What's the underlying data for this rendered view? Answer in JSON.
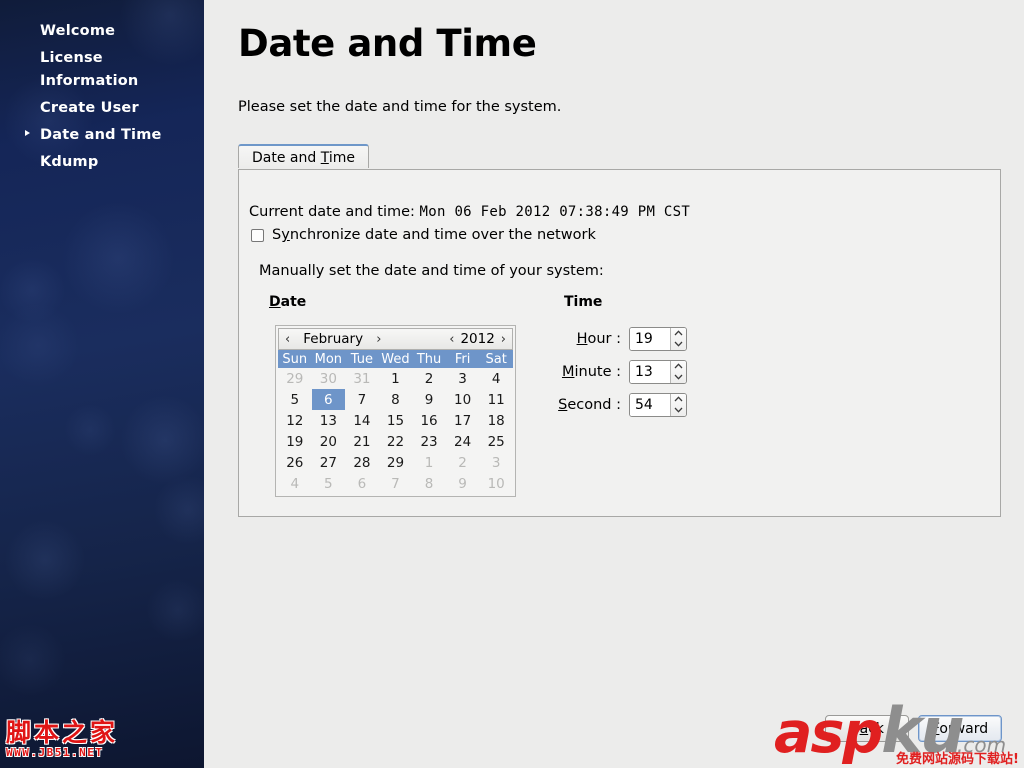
{
  "sidebar": {
    "items": [
      {
        "label": "Welcome",
        "current": false
      },
      {
        "label": "License\nInformation",
        "current": false
      },
      {
        "label": "Create User",
        "current": false
      },
      {
        "label": "Date and Time",
        "current": true
      },
      {
        "label": "Kdump",
        "current": false
      }
    ]
  },
  "watermark_left": {
    "brand": "脚本之家",
    "url": "WWW.JB51.NET"
  },
  "watermark_right": {
    "part1": "asp",
    "part2": "ku",
    "suffix": ".com",
    "subtitle": "免费网站源码下载站!"
  },
  "page": {
    "title": "Date and Time",
    "subtitle": "Please set the date and time for the system."
  },
  "tabs": [
    {
      "label": "Date and Time",
      "mnemonic": "T",
      "active": true
    }
  ],
  "panel": {
    "current_label": "Current date and time:",
    "current_value": "Mon 06 Feb 2012 07:38:49 PM CST",
    "sync_checkbox": {
      "label_before": "S",
      "mnemonic": "y",
      "label_after": "nchronize date and time over the network",
      "checked": false
    },
    "manual_label": "Manually set the date and time of your system:",
    "date_group_label": "Date",
    "date_group_mnemonic": "D",
    "time_group_label": "Time"
  },
  "calendar": {
    "prev_month_icon": "‹",
    "next_month_icon": "›",
    "month": "February",
    "prev_year_icon": "‹",
    "next_year_icon": "›",
    "year": "2012",
    "weekdays": [
      "Sun",
      "Mon",
      "Tue",
      "Wed",
      "Thu",
      "Fri",
      "Sat"
    ],
    "selected_day": 6,
    "weeks": [
      [
        {
          "d": "29",
          "dim": true
        },
        {
          "d": "30",
          "dim": true
        },
        {
          "d": "31",
          "dim": true
        },
        {
          "d": "1"
        },
        {
          "d": "2"
        },
        {
          "d": "3"
        },
        {
          "d": "4"
        }
      ],
      [
        {
          "d": "5"
        },
        {
          "d": "6",
          "sel": true
        },
        {
          "d": "7"
        },
        {
          "d": "8"
        },
        {
          "d": "9"
        },
        {
          "d": "10"
        },
        {
          "d": "11"
        }
      ],
      [
        {
          "d": "12"
        },
        {
          "d": "13"
        },
        {
          "d": "14"
        },
        {
          "d": "15"
        },
        {
          "d": "16"
        },
        {
          "d": "17"
        },
        {
          "d": "18"
        }
      ],
      [
        {
          "d": "19"
        },
        {
          "d": "20"
        },
        {
          "d": "21"
        },
        {
          "d": "22"
        },
        {
          "d": "23"
        },
        {
          "d": "24"
        },
        {
          "d": "25"
        }
      ],
      [
        {
          "d": "26"
        },
        {
          "d": "27"
        },
        {
          "d": "28"
        },
        {
          "d": "29"
        },
        {
          "d": "1",
          "dim": true
        },
        {
          "d": "2",
          "dim": true
        },
        {
          "d": "3",
          "dim": true
        }
      ],
      [
        {
          "d": "4",
          "dim": true
        },
        {
          "d": "5",
          "dim": true
        },
        {
          "d": "6",
          "dim": true
        },
        {
          "d": "7",
          "dim": true
        },
        {
          "d": "8",
          "dim": true
        },
        {
          "d": "9",
          "dim": true
        },
        {
          "d": "10",
          "dim": true
        }
      ]
    ]
  },
  "time": {
    "fields": [
      {
        "name": "hour",
        "label_before": "H",
        "mnemonic": "H",
        "label": "Hour :",
        "value": "19"
      },
      {
        "name": "minute",
        "label": "Minute :",
        "mnemonic": "M",
        "value": "13"
      },
      {
        "name": "second",
        "label": "Second :",
        "mnemonic": "S",
        "value": "54"
      }
    ],
    "hour_value": "19",
    "minute_value": "13",
    "second_value": "54",
    "hour_label": "our :",
    "minute_label": "inute :",
    "second_label": "econd :"
  },
  "footer": {
    "back_label_before": "B",
    "back_mnemonic": "a",
    "back_label_after": "ck",
    "back_label": "Back",
    "forward_label": "Forward",
    "forward_mnemonic": "F",
    "forward_focused": true
  },
  "colors": {
    "sidebar_bg": "#14255a",
    "accent_blue": "#6e95c9",
    "panel_bg": "#f1f1f0",
    "window_bg": "#ececeb",
    "watermark_red": "#e02020",
    "watermark_gray": "#8e8e8e"
  }
}
